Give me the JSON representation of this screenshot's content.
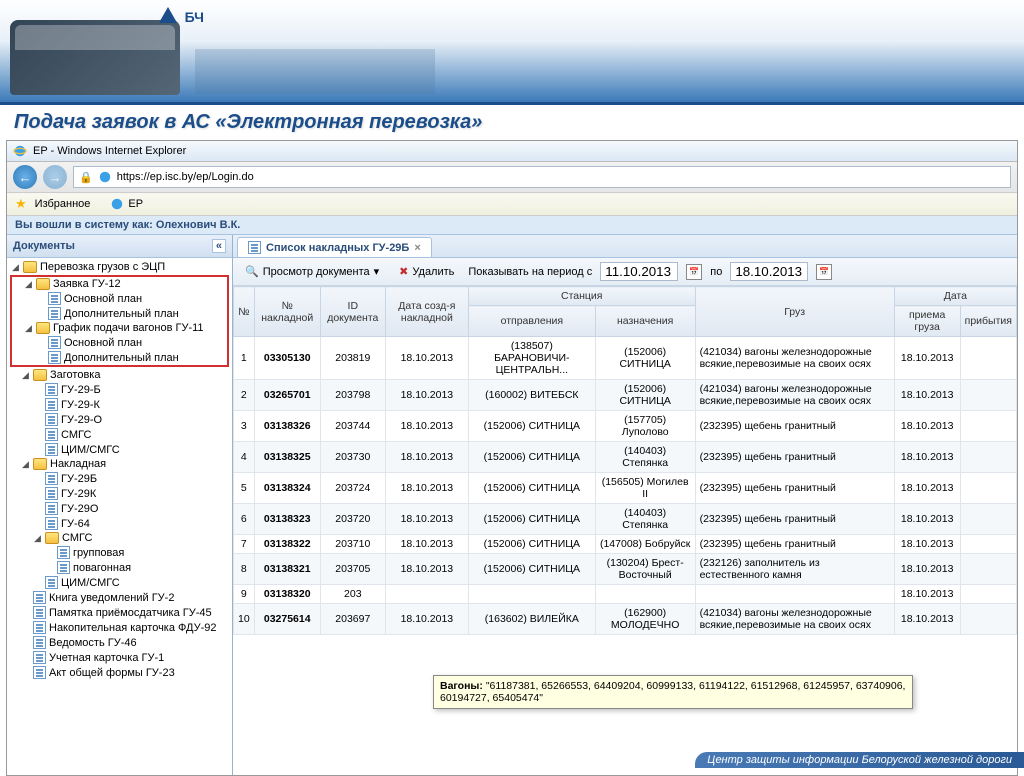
{
  "banner": {
    "logo_text": "БЧ"
  },
  "slide_title": "Подача заявок в АС «Электронная перевозка»",
  "browser": {
    "title": "EP - Windows Internet Explorer",
    "url": "https://ep.isc.by/ep/Login.do",
    "fav_label": "Избранное",
    "tab_title": "EP"
  },
  "login_bar": "Вы вошли в систему как: Олехнович В.К.",
  "sidebar": {
    "title": "Документы",
    "tree": [
      {
        "type": "folder",
        "label": "Перевозка грузов с ЭЦП",
        "expanded": true,
        "indent": 0,
        "hl": false
      },
      {
        "type": "folder",
        "label": "Заявка ГУ-12",
        "expanded": true,
        "indent": 1,
        "hl": true
      },
      {
        "type": "doc",
        "label": "Основной план",
        "indent": 2,
        "hl": true
      },
      {
        "type": "doc",
        "label": "Дополнительный план",
        "indent": 2,
        "hl": true
      },
      {
        "type": "folder",
        "label": "График подачи вагонов ГУ-11",
        "expanded": true,
        "indent": 1,
        "hl": true
      },
      {
        "type": "doc",
        "label": "Основной план",
        "indent": 2,
        "hl": true
      },
      {
        "type": "doc",
        "label": "Дополнительный план",
        "indent": 2,
        "hl": true
      },
      {
        "type": "folder",
        "label": "Заготовка",
        "expanded": true,
        "indent": 1,
        "hl": false
      },
      {
        "type": "doc",
        "label": "ГУ-29-Б",
        "indent": 2,
        "hl": false
      },
      {
        "type": "doc",
        "label": "ГУ-29-К",
        "indent": 2,
        "hl": false
      },
      {
        "type": "doc",
        "label": "ГУ-29-О",
        "indent": 2,
        "hl": false
      },
      {
        "type": "doc",
        "label": "СМГС",
        "indent": 2,
        "hl": false
      },
      {
        "type": "doc",
        "label": "ЦИМ/СМГС",
        "indent": 2,
        "hl": false
      },
      {
        "type": "folder",
        "label": "Накладная",
        "expanded": true,
        "indent": 1,
        "hl": false
      },
      {
        "type": "doc",
        "label": "ГУ-29Б",
        "indent": 2,
        "hl": false
      },
      {
        "type": "doc",
        "label": "ГУ-29К",
        "indent": 2,
        "hl": false
      },
      {
        "type": "doc",
        "label": "ГУ-29О",
        "indent": 2,
        "hl": false
      },
      {
        "type": "doc",
        "label": "ГУ-64",
        "indent": 2,
        "hl": false
      },
      {
        "type": "folder",
        "label": "СМГС",
        "expanded": true,
        "indent": 2,
        "hl": false
      },
      {
        "type": "doc",
        "label": "групповая",
        "indent": 3,
        "hl": false
      },
      {
        "type": "doc",
        "label": "повагонная",
        "indent": 3,
        "hl": false
      },
      {
        "type": "doc",
        "label": "ЦИМ/СМГС",
        "indent": 2,
        "hl": false
      },
      {
        "type": "doc",
        "label": "Книга уведомлений ГУ-2",
        "indent": 1,
        "hl": false
      },
      {
        "type": "doc",
        "label": "Памятка приёмосдатчика ГУ-45",
        "indent": 1,
        "hl": false
      },
      {
        "type": "doc",
        "label": "Накопительная карточка ФДУ-92",
        "indent": 1,
        "hl": false
      },
      {
        "type": "doc",
        "label": "Ведомость ГУ-46",
        "indent": 1,
        "hl": false
      },
      {
        "type": "doc",
        "label": "Учетная карточка ГУ-1",
        "indent": 1,
        "hl": false
      },
      {
        "type": "doc",
        "label": "Акт общей формы ГУ-23",
        "indent": 1,
        "hl": false
      }
    ]
  },
  "tab": {
    "title": "Список накладных ГУ-29Б"
  },
  "toolbar": {
    "view_doc": "Просмотр документа",
    "delete": "Удалить",
    "period_label": "Показывать на период с",
    "date_from": "11.10.2013",
    "period_to": "по",
    "date_to": "18.10.2013"
  },
  "table": {
    "headers": {
      "num": "№",
      "waybill_no": "№ накладной",
      "doc_id": "ID документа",
      "create_date": "Дата созд-я накладной",
      "station_group": "Станция",
      "station_dep": "отправления",
      "station_arr": "назначения",
      "cargo": "Груз",
      "date_group": "Дата",
      "date_cargo": "приема груза",
      "date_arr": "прибытия"
    },
    "rows": [
      {
        "n": "1",
        "wb": "03305130",
        "doc": "203819",
        "cd": "18.10.2013",
        "dep": "(138507) БАРАНОВИЧИ-ЦЕНТРАЛЬН...",
        "arr": "(152006) СИТНИЦА",
        "cargo": "(421034) вагоны железнодорожные всякие,перевозимые на своих осях",
        "dcargo": "18.10.2013",
        "darr": ""
      },
      {
        "n": "2",
        "wb": "03265701",
        "doc": "203798",
        "cd": "18.10.2013",
        "dep": "(160002) ВИТЕБСК",
        "arr": "(152006) СИТНИЦА",
        "cargo": "(421034) вагоны железнодорожные всякие,перевозимые на своих осях",
        "dcargo": "18.10.2013",
        "darr": ""
      },
      {
        "n": "3",
        "wb": "03138326",
        "doc": "203744",
        "cd": "18.10.2013",
        "dep": "(152006) СИТНИЦА",
        "arr": "(157705) Луполово",
        "cargo": "(232395) щебень гранитный",
        "dcargo": "18.10.2013",
        "darr": ""
      },
      {
        "n": "4",
        "wb": "03138325",
        "doc": "203730",
        "cd": "18.10.2013",
        "dep": "(152006) СИТНИЦА",
        "arr": "(140403) Степянка",
        "cargo": "(232395) щебень гранитный",
        "dcargo": "18.10.2013",
        "darr": ""
      },
      {
        "n": "5",
        "wb": "03138324",
        "doc": "203724",
        "cd": "18.10.2013",
        "dep": "(152006) СИТНИЦА",
        "arr": "(156505) Могилев II",
        "cargo": "(232395) щебень гранитный",
        "dcargo": "18.10.2013",
        "darr": ""
      },
      {
        "n": "6",
        "wb": "03138323",
        "doc": "203720",
        "cd": "18.10.2013",
        "dep": "(152006) СИТНИЦА",
        "arr": "(140403) Степянка",
        "cargo": "(232395) щебень гранитный",
        "dcargo": "18.10.2013",
        "darr": ""
      },
      {
        "n": "7",
        "wb": "03138322",
        "doc": "203710",
        "cd": "18.10.2013",
        "dep": "(152006) СИТНИЦА",
        "arr": "(147008) Бобруйск",
        "cargo": "(232395) щебень гранитный",
        "dcargo": "18.10.2013",
        "darr": ""
      },
      {
        "n": "8",
        "wb": "03138321",
        "doc": "203705",
        "cd": "18.10.2013",
        "dep": "(152006) СИТНИЦА",
        "arr": "(130204) Брест-Восточный",
        "cargo": "(232126) заполнитель из естественного камня",
        "dcargo": "18.10.2013",
        "darr": ""
      },
      {
        "n": "9",
        "wb": "03138320",
        "doc": "203",
        "cd": "",
        "dep": "",
        "arr": "",
        "cargo": "",
        "dcargo": "18.10.2013",
        "darr": ""
      },
      {
        "n": "10",
        "wb": "03275614",
        "doc": "203697",
        "cd": "18.10.2013",
        "dep": "(163602) ВИЛЕЙКА",
        "arr": "(162900) МОЛОДЕЧНО",
        "cargo": "(421034) вагоны железнодорожные всякие,перевозимые на своих осях",
        "dcargo": "18.10.2013",
        "darr": ""
      }
    ]
  },
  "tooltip": {
    "label": "Вагоны:",
    "value": "\"61187381, 65266553, 64409204, 60999133, 61194122, 61512968, 61245957, 63740906, 60194727, 65405474\""
  },
  "footer": "Центр защиты информации Белоруской железной дороги"
}
